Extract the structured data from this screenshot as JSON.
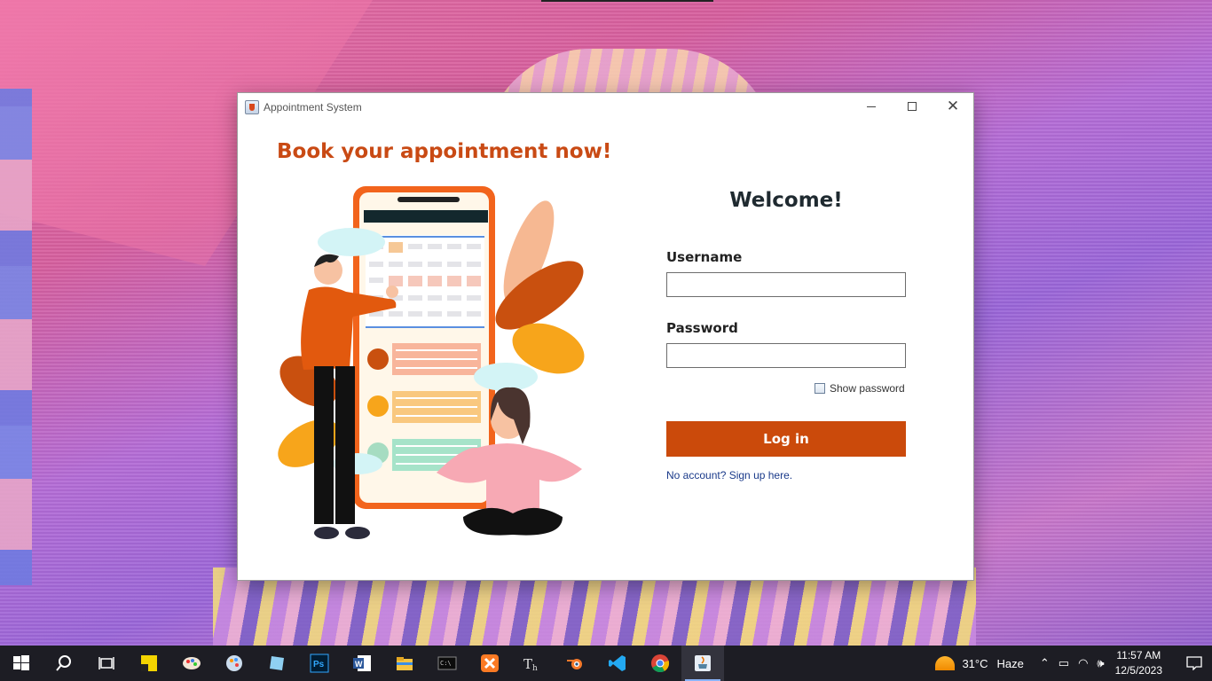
{
  "window": {
    "title": "Appointment System",
    "controls": {
      "minimize": "minimize",
      "maximize": "maximize",
      "close": "close"
    }
  },
  "left_panel": {
    "headline": "Book your appointment now!"
  },
  "login": {
    "welcome": "Welcome!",
    "username_label": "Username",
    "username_value": "",
    "password_label": "Password",
    "password_value": "",
    "show_password_label": "Show password",
    "show_password_checked": false,
    "login_button": "Log in",
    "signup_link": "No account? Sign up here."
  },
  "colors": {
    "accent": "#cb4a0b",
    "headline": "#c94a14",
    "link": "#1a3a8a"
  },
  "taskbar": {
    "apps": [
      {
        "icon": "windows-start-icon"
      },
      {
        "icon": "search-icon"
      },
      {
        "icon": "task-view-icon"
      },
      {
        "icon": "sticky-notes-icon"
      },
      {
        "icon": "paint-icon"
      },
      {
        "icon": "paint-3d-icon"
      },
      {
        "icon": "snipping-tool-icon"
      },
      {
        "icon": "photoshop-icon"
      },
      {
        "icon": "word-icon"
      },
      {
        "icon": "file-explorer-icon"
      },
      {
        "icon": "terminal-icon"
      },
      {
        "icon": "xampp-icon"
      },
      {
        "icon": "typora-icon"
      },
      {
        "icon": "blender-icon"
      },
      {
        "icon": "vscode-icon"
      },
      {
        "icon": "chrome-icon"
      },
      {
        "icon": "java-icon",
        "active": true
      }
    ],
    "weather": {
      "temp": "31°C",
      "condition": "Haze"
    },
    "clock": {
      "time": "11:57 AM",
      "date": "12/5/2023"
    }
  }
}
